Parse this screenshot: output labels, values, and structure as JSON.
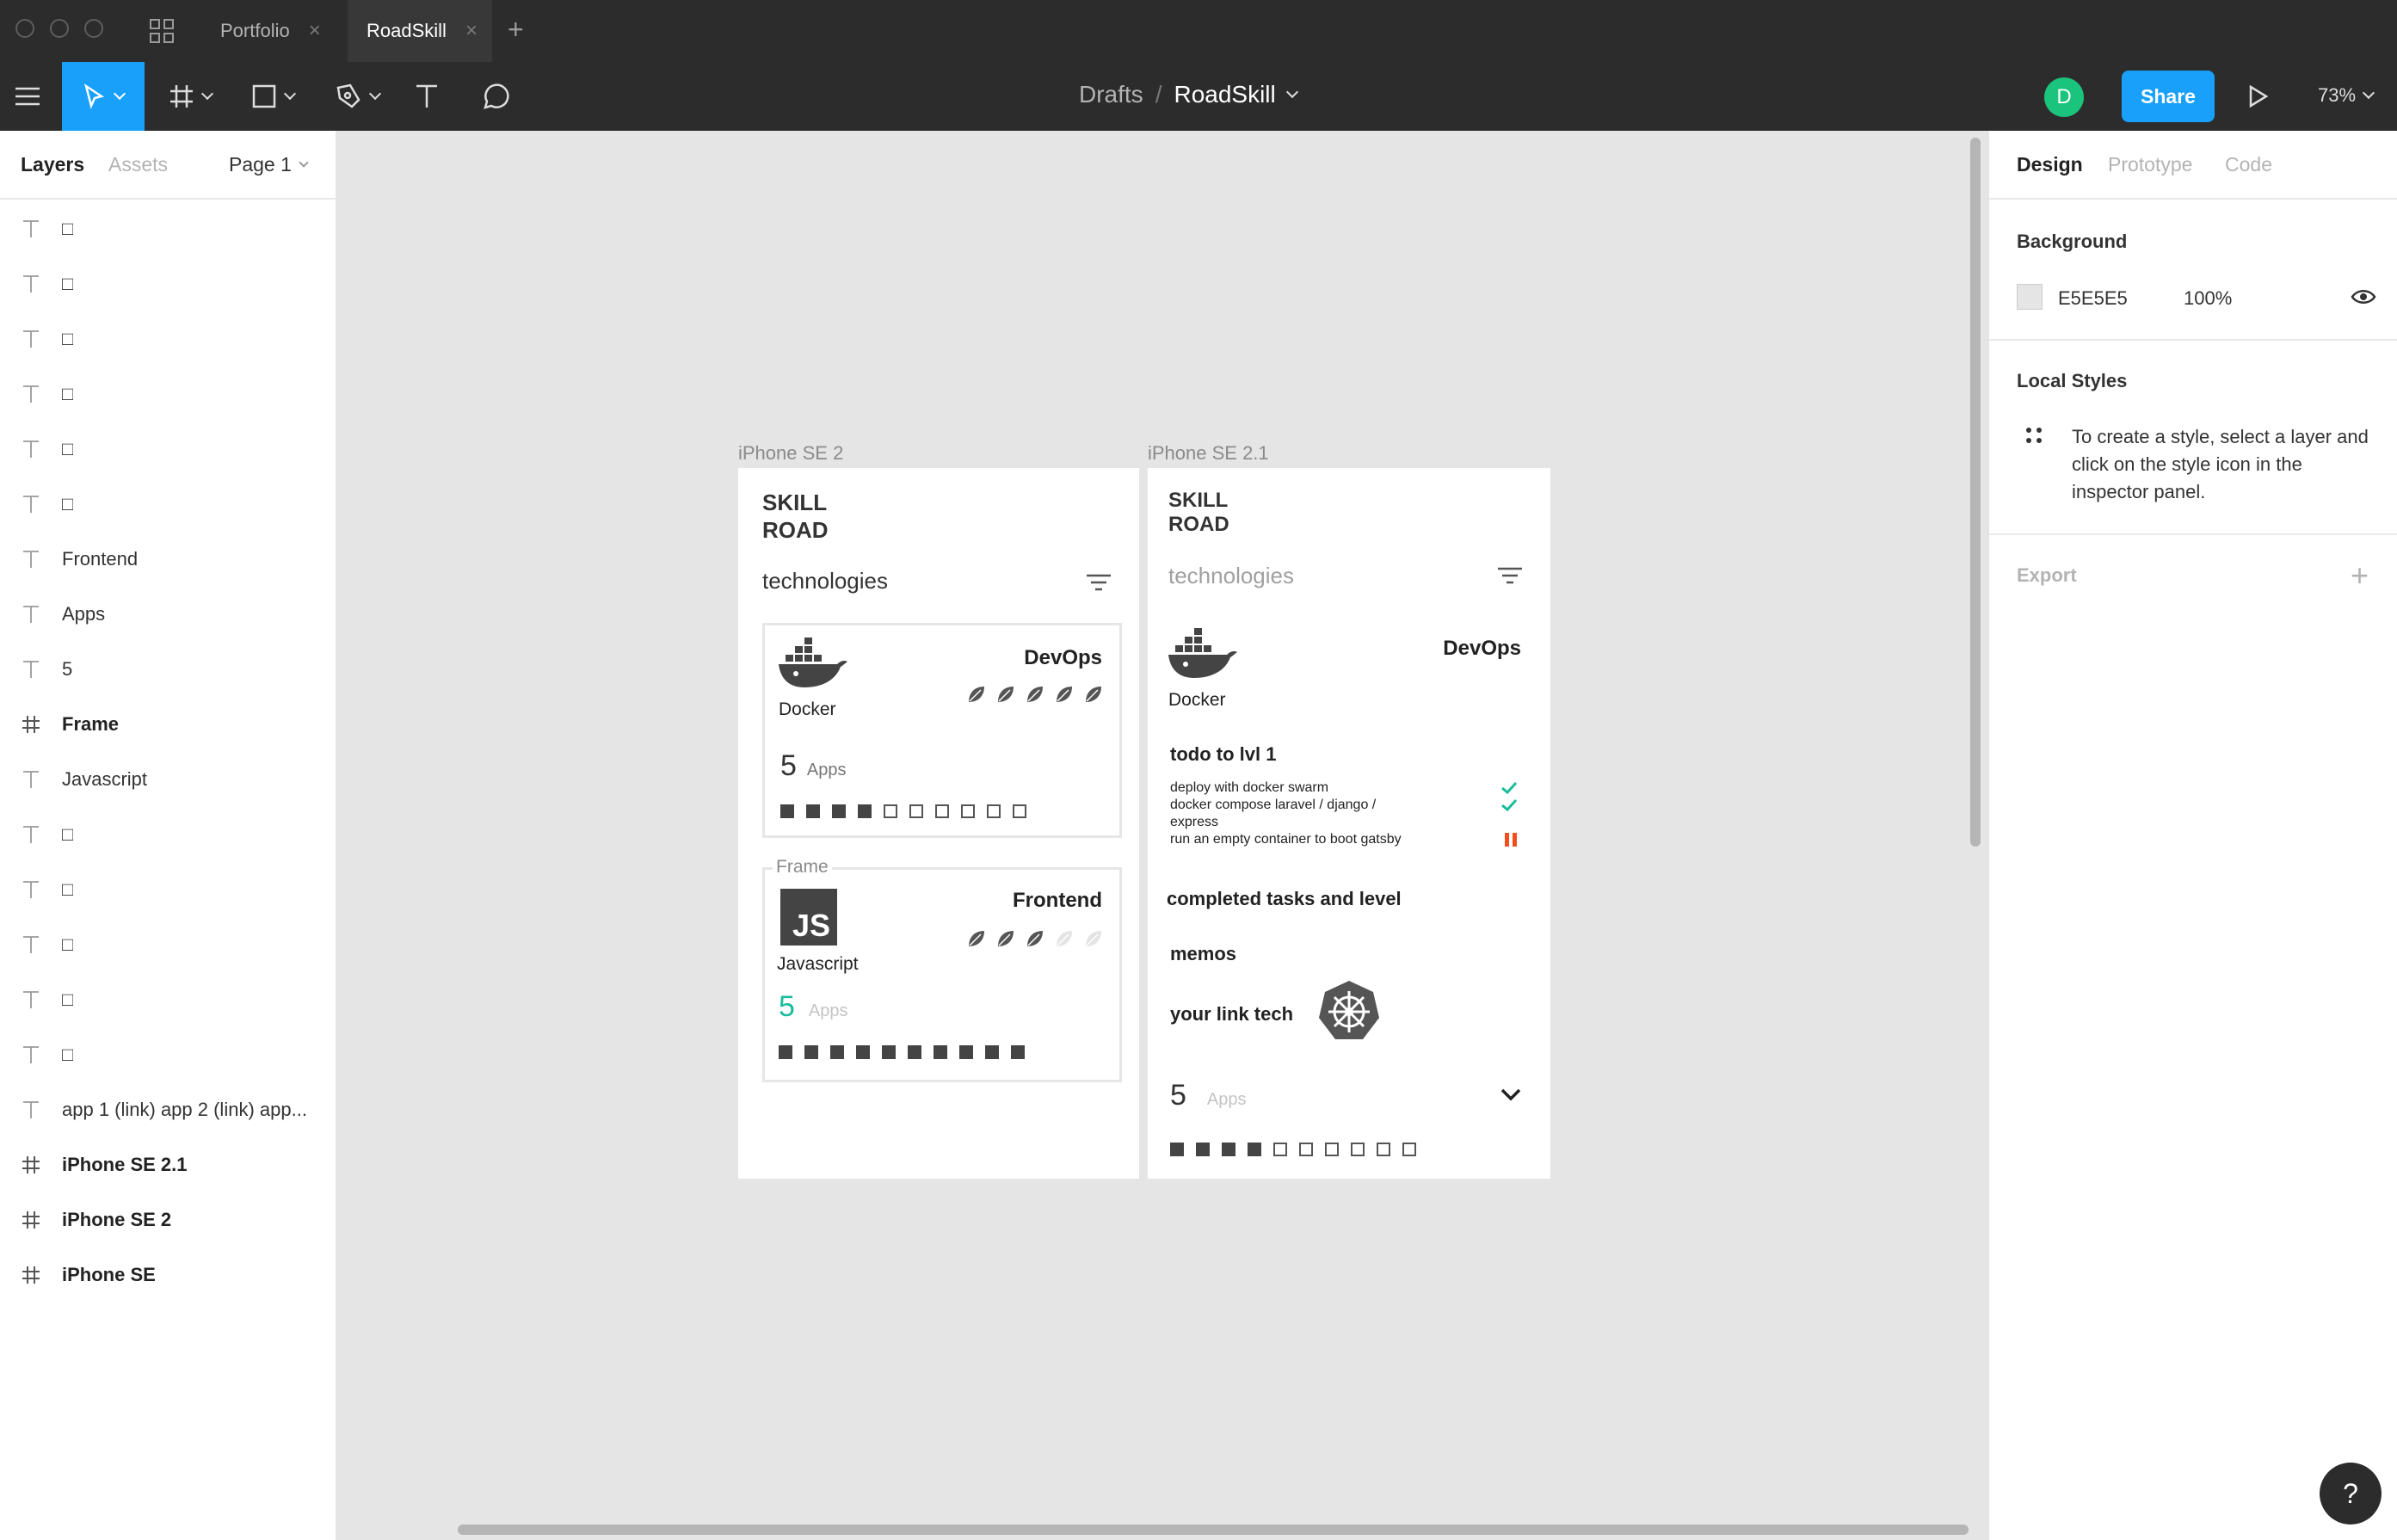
{
  "tabs": [
    {
      "label": "Portfolio"
    },
    {
      "label": "RoadSkill"
    }
  ],
  "toolbar": {
    "breadcrumb_parent": "Drafts",
    "breadcrumb_sep": "/",
    "file_name": "RoadSkill",
    "avatar_initial": "D",
    "share_label": "Share",
    "zoom": "73%"
  },
  "left_panel": {
    "tabs": {
      "layers": "Layers",
      "assets": "Assets",
      "page": "Page 1"
    },
    "layers": [
      {
        "icon": "text-icon",
        "label": "□"
      },
      {
        "icon": "text-icon",
        "label": "□"
      },
      {
        "icon": "text-icon",
        "label": "□"
      },
      {
        "icon": "text-icon",
        "label": "□"
      },
      {
        "icon": "text-icon",
        "label": "□"
      },
      {
        "icon": "text-icon",
        "label": "□"
      },
      {
        "icon": "text-icon",
        "label": "Frontend"
      },
      {
        "icon": "text-icon",
        "label": "Apps"
      },
      {
        "icon": "text-icon",
        "label": "5"
      },
      {
        "icon": "frame-icon",
        "label": "Frame"
      },
      {
        "icon": "text-icon",
        "label": "Javascript"
      },
      {
        "icon": "text-icon",
        "label": "□"
      },
      {
        "icon": "text-icon",
        "label": "□"
      },
      {
        "icon": "text-icon",
        "label": "□"
      },
      {
        "icon": "text-icon",
        "label": "□"
      },
      {
        "icon": "text-icon",
        "label": "□"
      },
      {
        "icon": "text-icon",
        "label": "app 1 (link) app 2 (link) app..."
      },
      {
        "icon": "frame-icon",
        "label": "iPhone SE 2.1"
      },
      {
        "icon": "frame-icon",
        "label": "iPhone SE 2"
      },
      {
        "icon": "frame-icon",
        "label": "iPhone SE"
      }
    ]
  },
  "right_panel": {
    "tabs": {
      "design": "Design",
      "prototype": "Prototype",
      "code": "Code"
    },
    "background_title": "Background",
    "background_hex": "E5E5E5",
    "background_opacity": "100%",
    "background_color": "#e5e5e5",
    "local_styles_title": "Local Styles",
    "local_styles_hint": "To create a style, select a layer and click on the style icon in the inspector panel.",
    "export_title": "Export"
  },
  "canvas": {
    "frame1": {
      "name": "iPhone SE 2",
      "logo_line1": "SKILL",
      "logo_line2": "ROAD",
      "technologies": "technologies",
      "card1": {
        "category": "DevOps",
        "tech": "Docker",
        "count": "5",
        "unit": "Apps",
        "level": 4,
        "level_max": 10,
        "leaves": 5,
        "leaves_max": 5
      },
      "frame_label": "Frame",
      "card2": {
        "category": "Frontend",
        "tech": "Javascript",
        "badge": "JS",
        "count": "5",
        "unit": "Apps",
        "level": 10,
        "level_max": 10,
        "leaves": 3,
        "leaves_max": 5
      }
    },
    "frame2": {
      "name": "iPhone SE 2.1",
      "logo_line1": "SKILL",
      "logo_line2": "ROAD",
      "technologies": "technologies",
      "category": "DevOps",
      "tech": "Docker",
      "todo_title": "todo to lvl 1",
      "todo_items": [
        {
          "line1": "deploy with docker swarm",
          "line2": "",
          "status": "done"
        },
        {
          "line1": "docker compose laravel / django /",
          "line2": "express",
          "status": "done"
        },
        {
          "line1": "run an empty container to boot gatsby",
          "line2": "",
          "status": "paused"
        }
      ],
      "completed_title": "completed tasks and level",
      "memos_title": "memos",
      "link_title": "your link tech",
      "count": "5",
      "unit": "Apps",
      "level": 4,
      "level_max": 10
    }
  },
  "colors": {
    "accent": "#18a0fb",
    "avatar": "#1bc47d",
    "teal": "#1abc9c",
    "orange": "#f24e1e"
  }
}
